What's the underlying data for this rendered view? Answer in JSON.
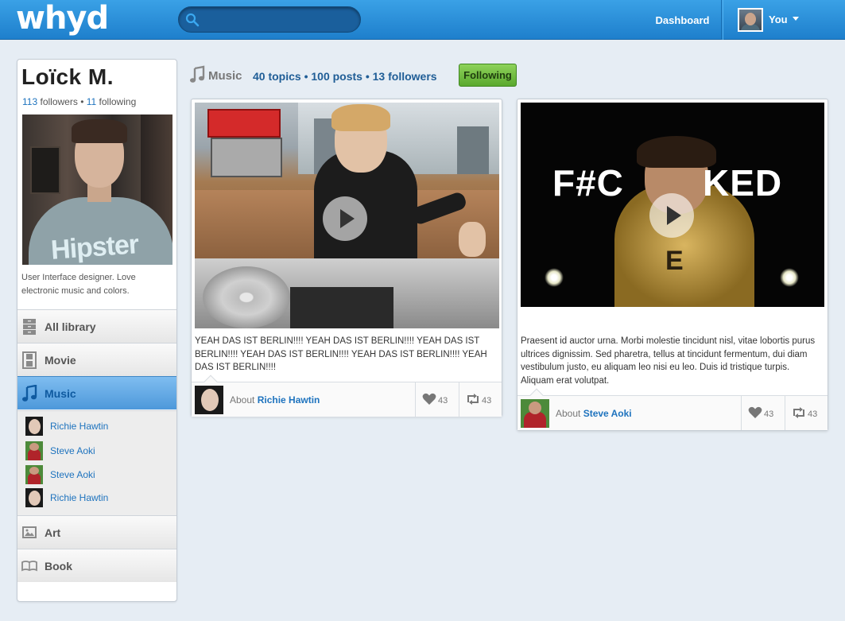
{
  "header": {
    "logo": "whyd",
    "search_placeholder": "",
    "nav_dashboard": "Dashboard",
    "nav_user": "You"
  },
  "profile": {
    "name": "Loïck M.",
    "followers_count": "113",
    "followers_label": "followers",
    "separator": "•",
    "following_count": "11",
    "following_label": "following",
    "shirt_text": "Hipster",
    "bio": "User Interface designer. Love electronic music and colors."
  },
  "sidebar": {
    "items": [
      {
        "label": "All library",
        "icon": "library-icon"
      },
      {
        "label": "Movie",
        "icon": "film-icon"
      },
      {
        "label": "Music",
        "icon": "music-icon",
        "active": true
      },
      {
        "label": "Art",
        "icon": "picture-icon"
      },
      {
        "label": "Book",
        "icon": "book-icon"
      }
    ],
    "music_artists": [
      "Richie Hawtin",
      "Steve Aoki",
      "Steve Aoki",
      "Richie Hawtin"
    ]
  },
  "main": {
    "section_title": "Music",
    "section_stats": "40 topics • 100 posts • 13 followers",
    "follow_button": "Following"
  },
  "posts": [
    {
      "description": "YEAH DAS IST BERLIN!!!! YEAH DAS IST BERLIN!!!! YEAH DAS IST BERLIN!!!! YEAH DAS IST BERLIN!!!! YEAH DAS IST BERLIN!!!! YEAH DAS IST BERLIN!!!!",
      "about_prefix": "About",
      "about_name": "Richie Hawtin",
      "likes": "43",
      "reposts": "43"
    },
    {
      "video_text_left": "F#C",
      "video_text_right": "KED",
      "video_text_body": "E",
      "description": "Praesent id auctor urna. Morbi molestie tincidunt nisl, vitae lobortis purus ultrices dignissim. Sed pharetra, tellus at tincidunt fermentum, dui diam vestibulum justo, eu aliquam leo nisi eu leo. Duis id tristique turpis. Aliquam erat volutpat.",
      "about_prefix": "About",
      "about_name": "Steve Aoki",
      "likes": "43",
      "reposts": "43"
    }
  ],
  "colors": {
    "topbar": "#2a8fd9",
    "link": "#1e73be",
    "follow_button": "#6cba3e",
    "active_menu": "#5aa3e0"
  }
}
